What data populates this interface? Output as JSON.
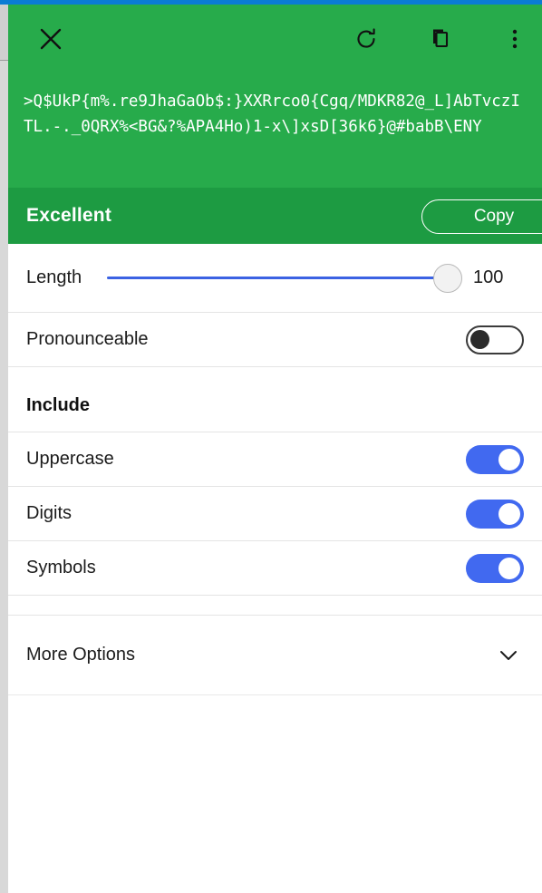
{
  "window": {
    "accent_blue": "#0a7cd4",
    "header_green": "#27ab4b",
    "strength_green": "#1d9b42",
    "toggle_on_color": "#4169f0",
    "slider_color": "#3b62e3"
  },
  "header": {
    "close_icon": "close-icon",
    "refresh_icon": "refresh-icon",
    "copy_icon": "copy-icon",
    "menu_icon": "overflow-menu-icon"
  },
  "password": {
    "value": ">Q$UkP{m%.re9JhaGaOb$:}XXRrco0{Cgq/MDKR82@_L]AbTvczITL.-._0QRX%<BG&?%APA4Ho)1-x\\]xsD[36k6}@#babB\\ENY"
  },
  "strength": {
    "label": "Excellent",
    "copy_label": "Copy"
  },
  "length": {
    "label": "Length",
    "value": "100",
    "min": "1",
    "max": "100",
    "percent": 100
  },
  "pronounceable": {
    "label": "Pronounceable",
    "state": "off"
  },
  "include": {
    "heading": "Include",
    "items": [
      {
        "label": "Uppercase",
        "state": "on"
      },
      {
        "label": "Digits",
        "state": "on"
      },
      {
        "label": "Symbols",
        "state": "on"
      }
    ]
  },
  "more_options": {
    "label": "More Options",
    "chevron_icon": "chevron-down-icon",
    "expanded": "false"
  }
}
